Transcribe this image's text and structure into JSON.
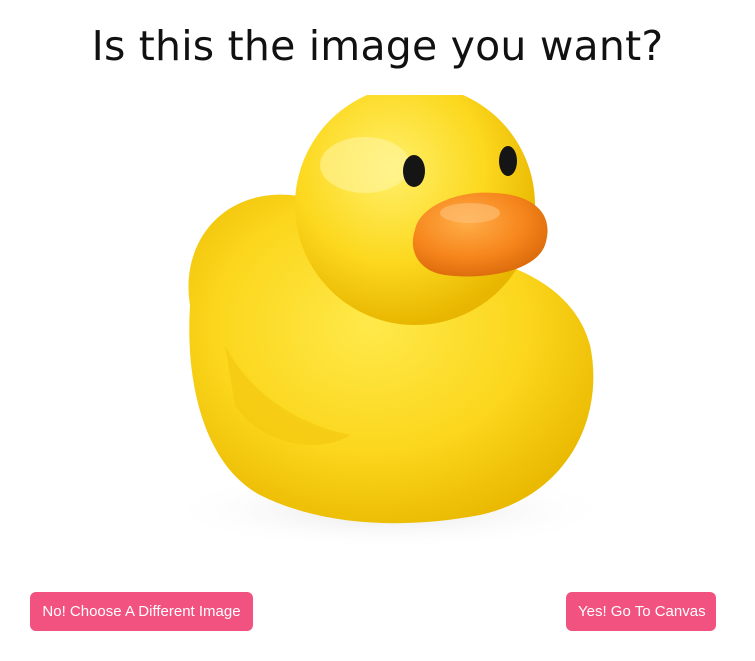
{
  "heading": "Is this the image you want?",
  "preview_image": "rubber-duck",
  "buttons": {
    "choose_different": "No! Choose A Different Image",
    "go_to_canvas": "Yes! Go To Canvas"
  },
  "colors": {
    "button_bg": "#f2527f",
    "button_text": "#ffffff",
    "heading": "#111111"
  }
}
